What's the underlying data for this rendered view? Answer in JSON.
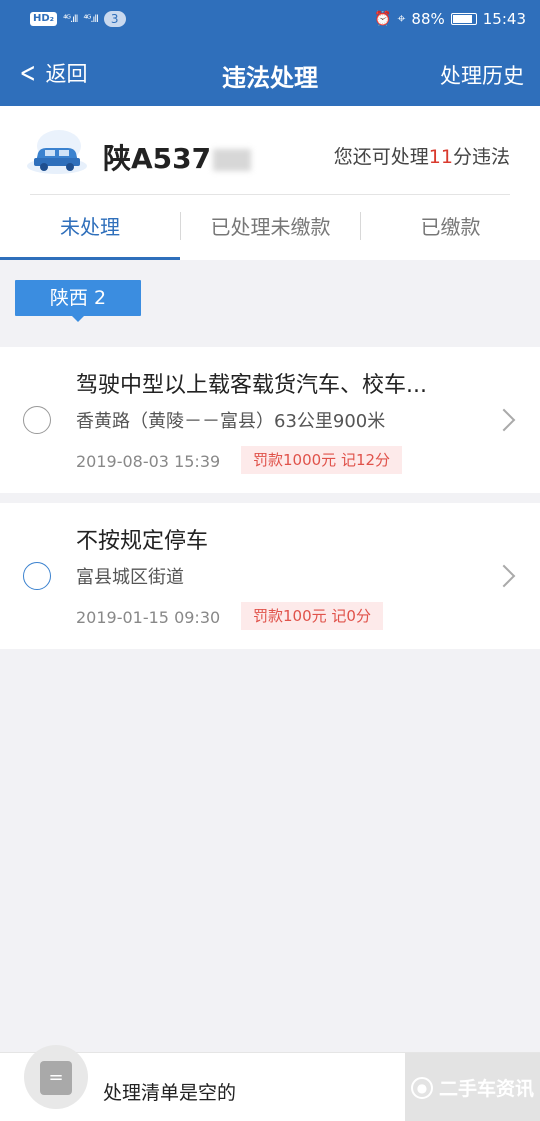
{
  "status_bar": {
    "hd": "HD₂",
    "signal_1": "⁴ᴳ.ıll",
    "signal_2": "⁴ᴳ.ıll",
    "badge": "3",
    "alarm_icon": "⏰",
    "location_icon": "⌖",
    "battery": "88%",
    "time": "15:43"
  },
  "nav": {
    "back_label": "返回",
    "title": "违法处理",
    "history_label": "处理历史"
  },
  "vehicle": {
    "plate": "陕A537",
    "quota_prefix": "您还可处理",
    "quota_points": "11",
    "quota_suffix": "分违法"
  },
  "tabs": [
    {
      "label": "未处理",
      "active": true
    },
    {
      "label": "已处理未缴款",
      "active": false
    },
    {
      "label": "已缴款",
      "active": false
    }
  ],
  "region_tag": "陕西 2",
  "violations": [
    {
      "title": "驾驶中型以上载客载货汽车、校车...",
      "location": "香黄路（黄陵－－富县）63公里900米",
      "time": "2019-08-03 15:39",
      "fine": "罚款1000元 记12分"
    },
    {
      "title": "不按规定停车",
      "location": "富县城区街道",
      "time": "2019-01-15 09:30",
      "fine": "罚款100元 记0分"
    }
  ],
  "bottom_bar": {
    "cart_icon_char": "=",
    "empty_text": "处理清单是空的",
    "watermark_text": "二手车资讯"
  },
  "colors": {
    "primary": "#2f6fbb",
    "accent_blue": "#3b8de0",
    "highlight_red": "#d93a2e",
    "fine_bg": "#fdeaea",
    "fine_text": "#e0524a"
  }
}
